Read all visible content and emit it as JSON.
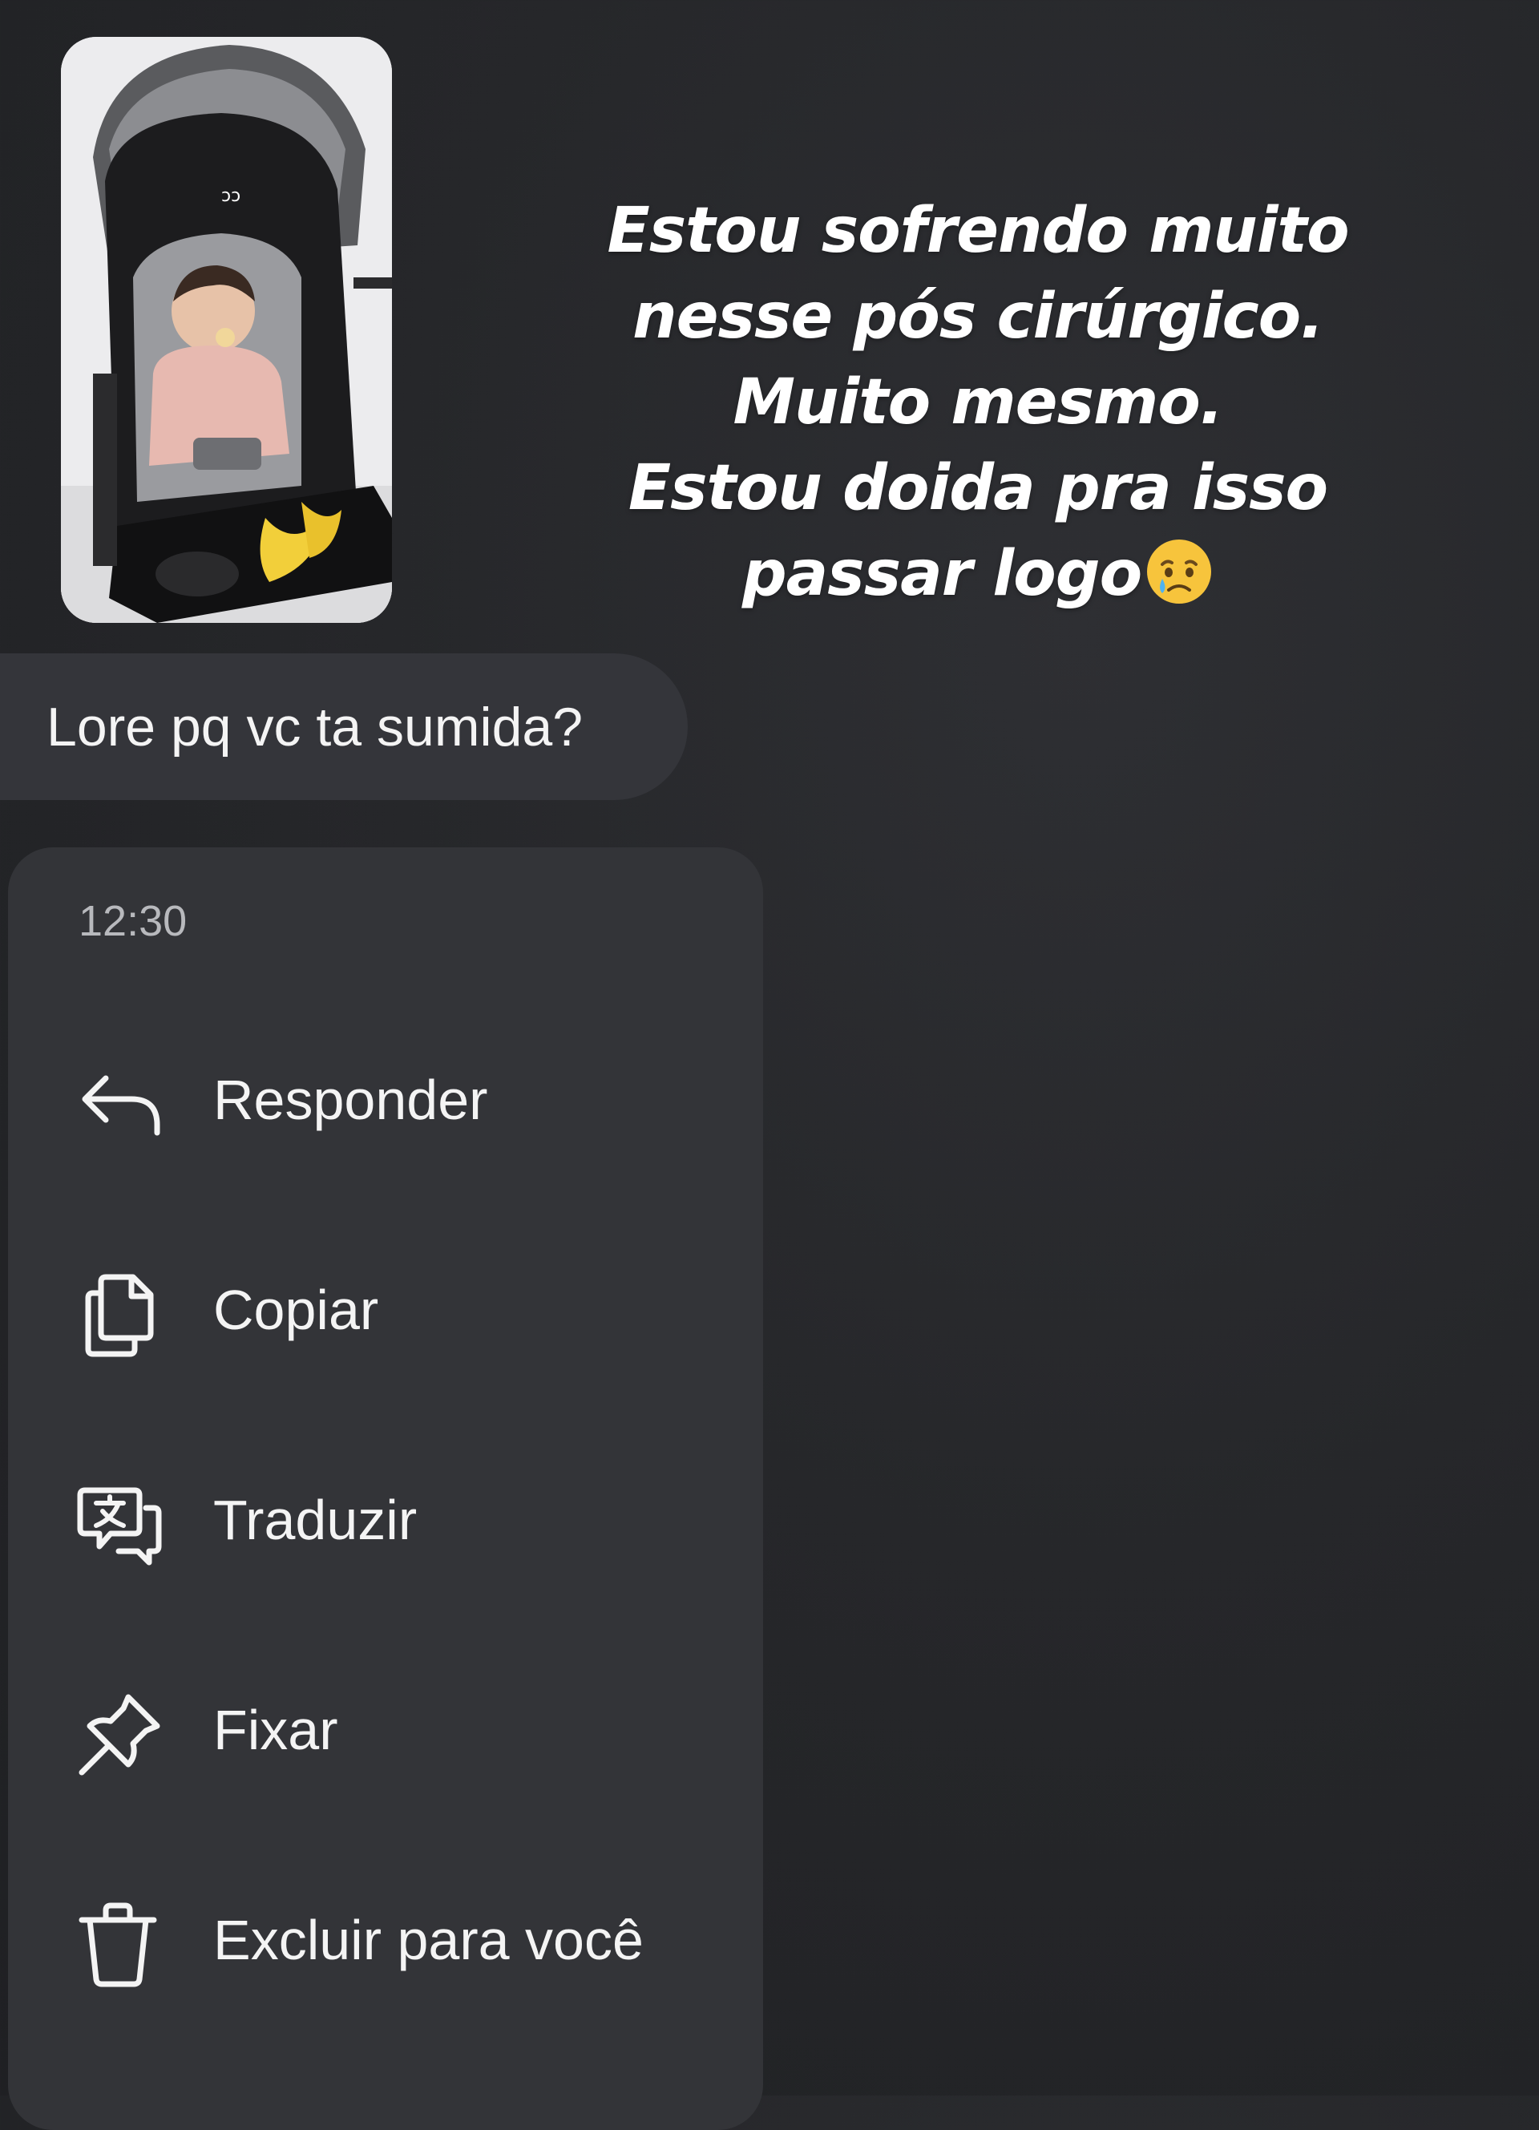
{
  "story": {
    "text_lines": [
      "Estou sofrendo muito",
      "nesse pós cirúrgico.",
      "Muito mesmo.",
      "Estou doida pra isso",
      "passar logo"
    ],
    "emoji": "crying-face-emoji"
  },
  "message": {
    "text": "Lore pq vc ta sumida?"
  },
  "context_menu": {
    "time": "12:30",
    "items": [
      {
        "label": "Responder",
        "icon": "reply-arrow-icon"
      },
      {
        "label": "Copiar",
        "icon": "copy-icon"
      },
      {
        "label": "Traduzir",
        "icon": "translate-icon"
      },
      {
        "label": "Fixar",
        "icon": "pin-icon"
      },
      {
        "label": "Excluir para você",
        "icon": "trash-icon"
      }
    ]
  },
  "colors": {
    "background": "#26272a",
    "bubble": "#34353a",
    "menu": "#333438",
    "text": "#f4f4f4",
    "muted_text": "#b8b9bd"
  }
}
